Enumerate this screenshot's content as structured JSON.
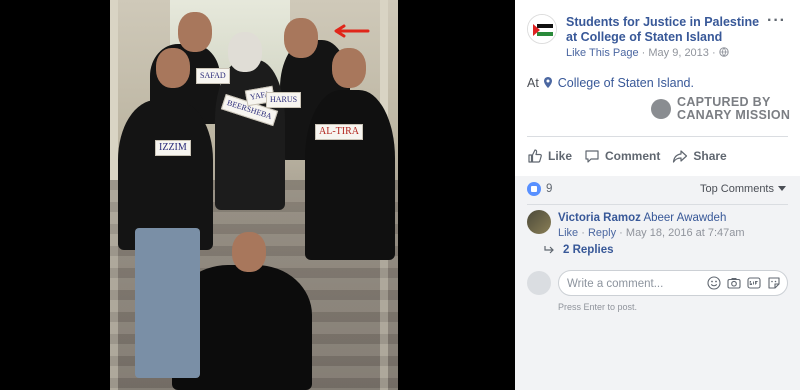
{
  "post": {
    "page_name": "Students for Justice in Palestine at College of Staten Island",
    "like_page": "Like This Page",
    "separator": "·",
    "date": "May 9, 2013",
    "more": "···"
  },
  "location": {
    "prefix": "At",
    "place": "College of Staten Island."
  },
  "watermark": {
    "line1": "CAPTURED BY",
    "line2": "CANARY MISSION"
  },
  "photo": {
    "signs": [
      "IZZIM",
      "SAFAD",
      "BEERSHEBA",
      "YAFA",
      "HARUS",
      "AL-TIRA"
    ]
  },
  "actions": {
    "like": "Like",
    "comment": "Comment",
    "share": "Share"
  },
  "reactions": {
    "count": "9",
    "sort_label": "Top Comments"
  },
  "comment": {
    "author": "Victoria Ramoz",
    "tagged": "Abeer Awawdeh",
    "like": "Like",
    "reply": "Reply",
    "separator": "·",
    "date": "May 18, 2016 at 7:47am",
    "replies": "2 Replies"
  },
  "composer": {
    "placeholder": "Write a comment...",
    "hint": "Press Enter to post."
  },
  "colors": {
    "link": "#385898",
    "muted": "#90949c",
    "comments_bg": "#f2f3f5",
    "like_blue": "#5890ff"
  },
  "icons": [
    "more-icon",
    "location-pin-icon",
    "globe-icon",
    "like-icon",
    "comment-icon",
    "share-icon",
    "reply-arrow-icon",
    "emoji-icon",
    "camera-icon",
    "gif-icon",
    "sticker-icon"
  ]
}
